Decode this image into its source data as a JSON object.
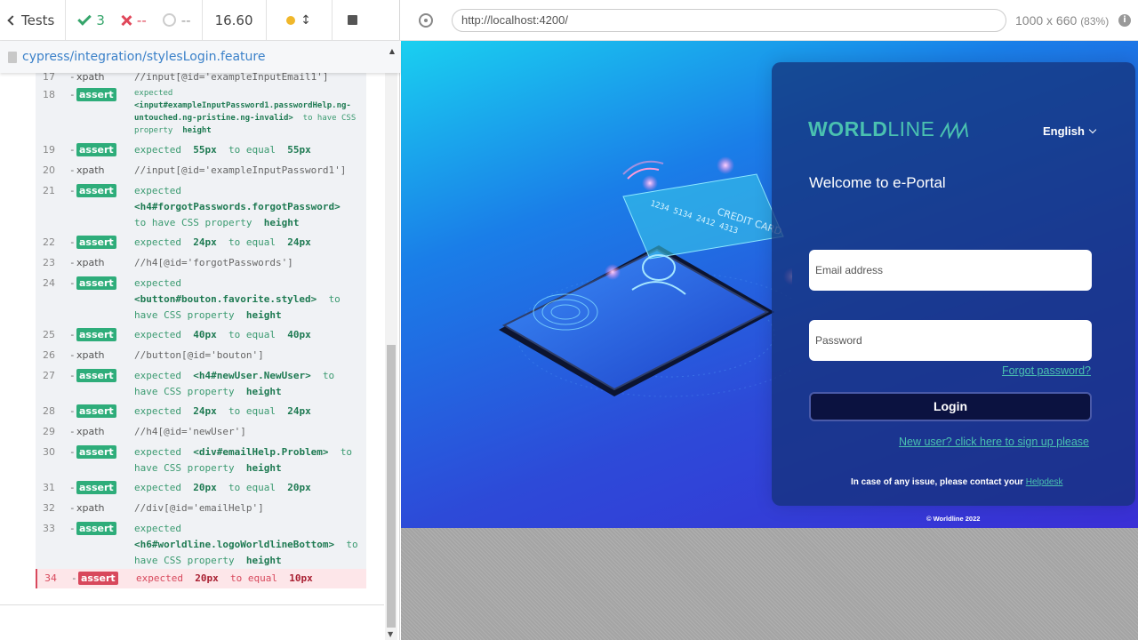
{
  "stats": {
    "tests_label": "Tests",
    "passed": "3",
    "failed": "--",
    "pending": "--",
    "duration": "16.60"
  },
  "spec": {
    "path": "cypress/integration/stylesLogin.feature"
  },
  "log": [
    {
      "num": "17",
      "type": "xpath",
      "msg": "//input[@id='exampleInputEmail1']"
    },
    {
      "num": "18",
      "type": "assert",
      "msg_pre": "expected",
      "msg_el": "<input#exampleInputPassword1.passwordHelp.ng-untouched.ng-pristine.ng-invalid>",
      "msg_mid": "to have CSS property",
      "msg_val": "height"
    },
    {
      "num": "19",
      "type": "assert",
      "msg_pre": "expected",
      "msg_el": "55px",
      "msg_mid": "to equal",
      "msg_val": "55px"
    },
    {
      "num": "20",
      "type": "xpath",
      "msg": "//input[@id='exampleInputPassword1']"
    },
    {
      "num": "21",
      "type": "assert",
      "msg_pre": "expected",
      "msg_el": "<h4#forgotPasswords.forgotPassword>",
      "msg_mid": "to have CSS property",
      "msg_val": "height"
    },
    {
      "num": "22",
      "type": "assert",
      "msg_pre": "expected",
      "msg_el": "24px",
      "msg_mid": "to equal",
      "msg_val": "24px"
    },
    {
      "num": "23",
      "type": "xpath",
      "msg": "//h4[@id='forgotPasswords']"
    },
    {
      "num": "24",
      "type": "assert",
      "msg_pre": "expected",
      "msg_el": "<button#bouton.favorite.styled>",
      "msg_mid": "to have CSS property",
      "msg_val": "height"
    },
    {
      "num": "25",
      "type": "assert",
      "msg_pre": "expected",
      "msg_el": "40px",
      "msg_mid": "to equal",
      "msg_val": "40px"
    },
    {
      "num": "26",
      "type": "xpath",
      "msg": "//button[@id='bouton']"
    },
    {
      "num": "27",
      "type": "assert",
      "msg_pre": "expected",
      "msg_el": "<h4#newUser.NewUser>",
      "msg_mid": "to have CSS property",
      "msg_val": "height"
    },
    {
      "num": "28",
      "type": "assert",
      "msg_pre": "expected",
      "msg_el": "24px",
      "msg_mid": "to equal",
      "msg_val": "24px"
    },
    {
      "num": "29",
      "type": "xpath",
      "msg": "//h4[@id='newUser']"
    },
    {
      "num": "30",
      "type": "assert",
      "msg_pre": "expected",
      "msg_el": "<div#emailHelp.Problem>",
      "msg_mid": "to have CSS property",
      "msg_val": "height"
    },
    {
      "num": "31",
      "type": "assert",
      "msg_pre": "expected",
      "msg_el": "20px",
      "msg_mid": "to equal",
      "msg_val": "20px"
    },
    {
      "num": "32",
      "type": "xpath",
      "msg": "//div[@id='emailHelp']"
    },
    {
      "num": "33",
      "type": "assert",
      "msg_pre": "expected",
      "msg_el": "<h6#worldline.logoWorldlineBottom>",
      "msg_mid": "to have CSS property",
      "msg_val": "height"
    },
    {
      "num": "34",
      "type": "assert",
      "failed": true,
      "msg_pre": "expected",
      "msg_el": "20px",
      "msg_mid": "to equal",
      "msg_val": "10px"
    }
  ],
  "browser": {
    "url": "http://localhost:4200/",
    "viewport": "1000 x 660",
    "zoom": "(83%)"
  },
  "login": {
    "logo_bold": "WORLD",
    "logo_thin": "LINE",
    "language": "English",
    "welcome": "Welcome to e-Portal",
    "email_placeholder": "Email address",
    "password_placeholder": "Password",
    "forgot": "Forgot password?",
    "login_button": "Login",
    "new_user": "New user? click here to sign up please",
    "issue_text": "In case of any issue, please contact your",
    "helpdesk": "Helpdesk",
    "copyright": "© Worldline 2022"
  },
  "illustration": {
    "card_text": "CREDIT CARD",
    "card_number": "1234 5134 2412 4313"
  },
  "colors": {
    "pass": "#36a56b",
    "fail": "#e0475a",
    "brand": "#4ac1b0",
    "link": "#3b81c9"
  }
}
